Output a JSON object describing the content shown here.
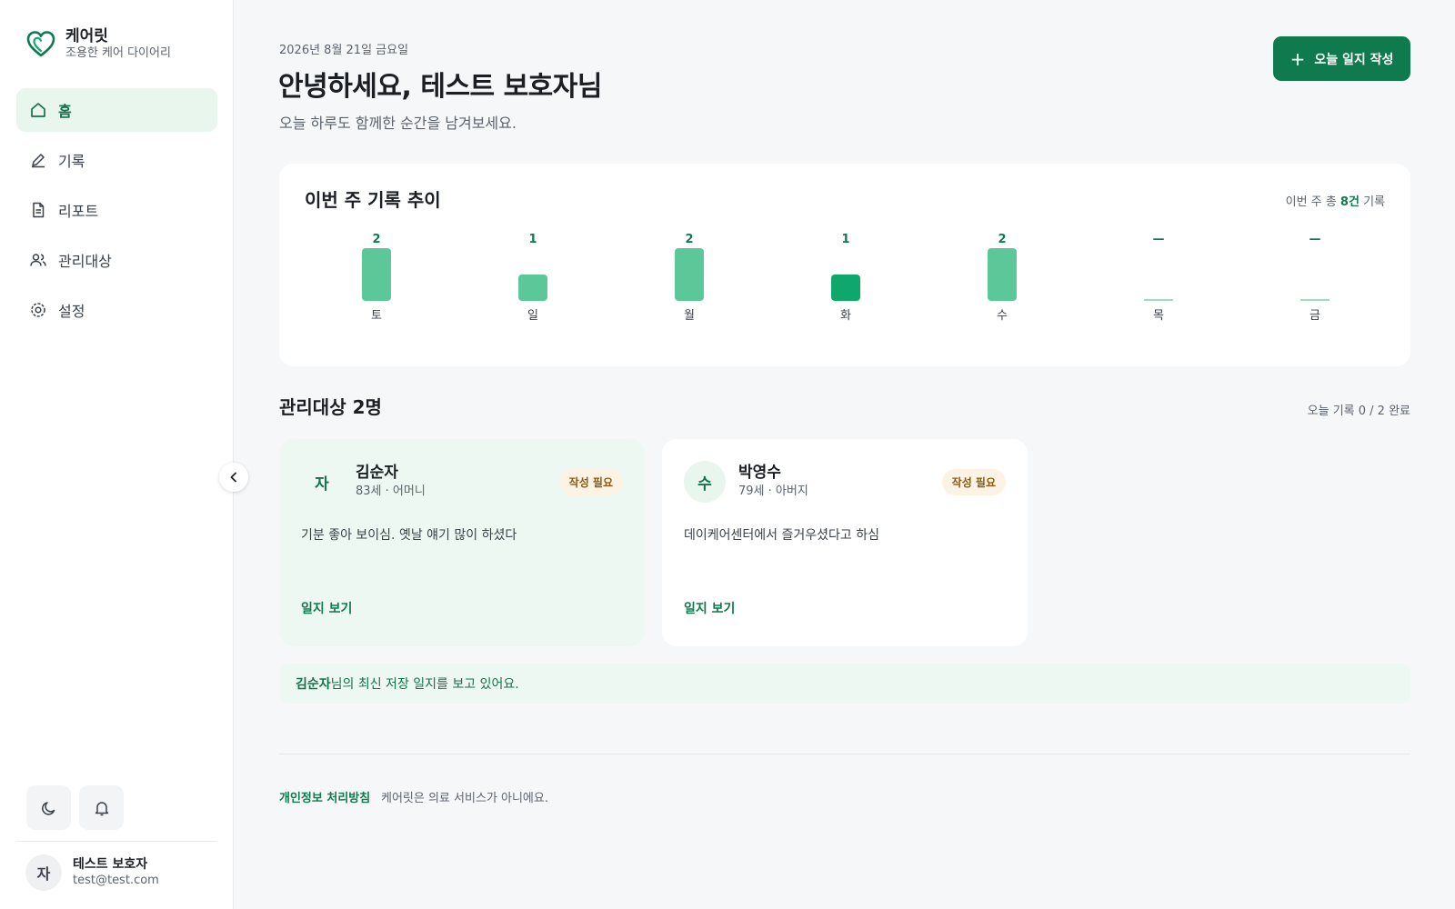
{
  "brand": {
    "name": "케어릿",
    "tagline": "조용한 케어 다이어리",
    "logo_icon": "heart-outline-icon",
    "accent": "#0f7a4e"
  },
  "nav": {
    "items": [
      {
        "label": "홈",
        "icon": "home-icon",
        "active": true
      },
      {
        "label": "기록",
        "icon": "pencil-icon",
        "active": false
      },
      {
        "label": "리포트",
        "icon": "document-icon",
        "active": false
      },
      {
        "label": "관리대상",
        "icon": "users-icon",
        "active": false
      },
      {
        "label": "설정",
        "icon": "gear-icon",
        "active": false
      }
    ]
  },
  "sidebar_bottom": {
    "theme_icon": "moon-icon",
    "bell_icon": "bell-icon",
    "profile": {
      "initial": "자",
      "name": "테스트 보호자",
      "email": "test@test.com"
    }
  },
  "header": {
    "date": "2026년 8월 21일 금요일",
    "greeting": "안녕하세요, 테스트 보호자님",
    "subtitle": "오늘 하루도 함께한 순간을 남겨보세요.",
    "write_button": "오늘 일지 작성"
  },
  "weekly": {
    "title": "이번 주 기록 추이",
    "total_prefix": "이번 주 총 ",
    "total_value": "8건",
    "total_suffix": " 기록"
  },
  "chart_data": {
    "type": "bar",
    "categories": [
      "토",
      "일",
      "월",
      "화",
      "수",
      "목",
      "금"
    ],
    "values": [
      2,
      1,
      2,
      1,
      2,
      0,
      0
    ],
    "value_labels": [
      "2",
      "1",
      "2",
      "1",
      "2",
      "—",
      "—"
    ],
    "highlight_index": 3,
    "ylim": [
      0,
      2
    ],
    "colors": {
      "bar": "#5cc799",
      "highlight": "#10a86a",
      "label": "#0f7a4e",
      "empty": "#9fdcc0"
    }
  },
  "recipients": {
    "title": "관리대상 2명",
    "status": "오늘 기록 0 / 2 완료",
    "cards": [
      {
        "initial": "자",
        "name": "김순자",
        "meta": "83세 · 어머니",
        "badge": "작성 필요",
        "note": "기분 좋아 보이심. 옛날 얘기 많이 하셨다",
        "link": "일지 보기",
        "selected": true
      },
      {
        "initial": "수",
        "name": "박영수",
        "meta": "79세 · 아버지",
        "badge": "작성 필요",
        "note": "데이케어센터에서 즐거우셨다고 하심",
        "link": "일지 보기",
        "selected": false
      }
    ]
  },
  "banner": {
    "name": "김순자",
    "text": "님의 최신 저장 일지를 보고 있어요."
  },
  "footer": {
    "privacy_link": "개인정보 처리방침",
    "disclaimer": "케어릿은 의료 서비스가 아니에요."
  }
}
